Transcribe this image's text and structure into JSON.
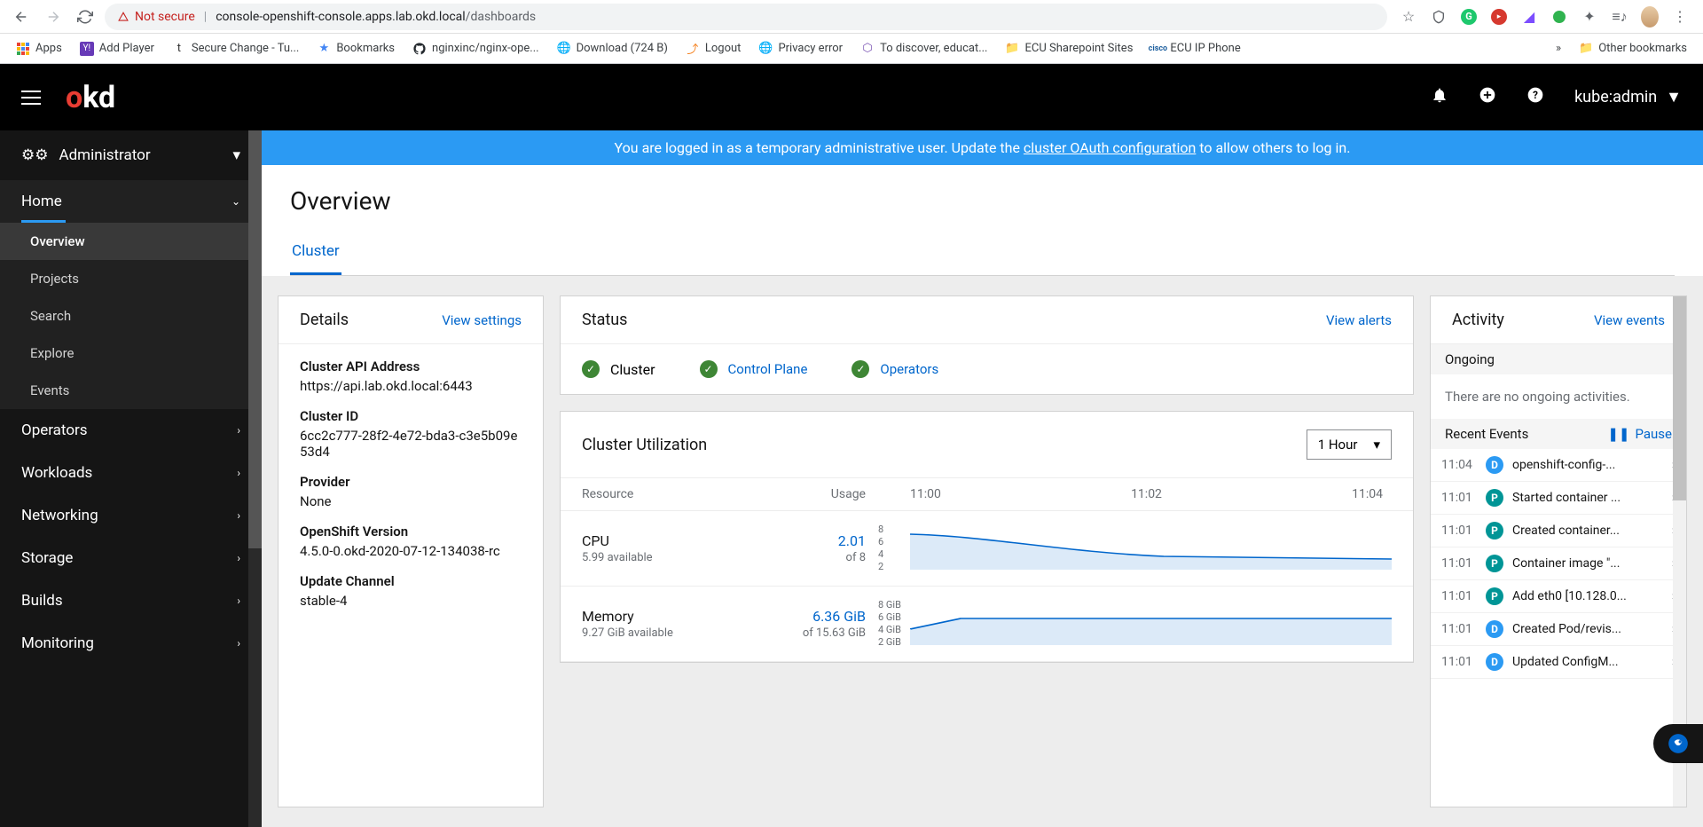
{
  "browser": {
    "not_secure": "Not secure",
    "url_host": "console-openshift-console.apps.lab.okd.local",
    "url_path": "/dashboards"
  },
  "bookmarks": {
    "apps": "Apps",
    "items": [
      "Add Player",
      "Secure Change - Tu...",
      "Bookmarks",
      "nginxinc/nginx-ope...",
      "Download (724 B)",
      "Logout",
      "Privacy error",
      "To discover, educat...",
      "ECU Sharepoint Sites",
      "ECU IP Phone"
    ],
    "other": "Other bookmarks"
  },
  "header": {
    "user": "kube:admin"
  },
  "sidebar": {
    "perspective": "Administrator",
    "home": "Home",
    "home_items": [
      "Overview",
      "Projects",
      "Search",
      "Explore",
      "Events"
    ],
    "sections": [
      "Operators",
      "Workloads",
      "Networking",
      "Storage",
      "Builds",
      "Monitoring"
    ]
  },
  "banner": {
    "pre": "You are logged in as a temporary administrative user. Update the ",
    "link": "cluster OAuth configuration",
    "post": " to allow others to log in."
  },
  "page": {
    "title": "Overview",
    "tab": "Cluster"
  },
  "details": {
    "title": "Details",
    "action": "View settings",
    "items": [
      {
        "label": "Cluster API Address",
        "value": "https://api.lab.okd.local:6443"
      },
      {
        "label": "Cluster ID",
        "value": "6cc2c777-28f2-4e72-bda3-c3e5b09e53d4"
      },
      {
        "label": "Provider",
        "value": "None"
      },
      {
        "label": "OpenShift Version",
        "value": "4.5.0-0.okd-2020-07-12-134038-rc"
      },
      {
        "label": "Update Channel",
        "value": "stable-4"
      }
    ]
  },
  "status": {
    "title": "Status",
    "action": "View alerts",
    "items": [
      {
        "label": "Cluster",
        "link": false
      },
      {
        "label": "Control Plane",
        "link": true
      },
      {
        "label": "Operators",
        "link": true
      }
    ]
  },
  "utilization": {
    "title": "Cluster Utilization",
    "range": "1 Hour",
    "resource_h": "Resource",
    "usage_h": "Usage",
    "times": [
      "11:00",
      "11:02",
      "11:04"
    ],
    "rows": [
      {
        "name": "CPU",
        "sub": "5.99 available",
        "val": "2.01",
        "valsub": "of 8",
        "ticks": [
          "8",
          "6",
          "4",
          "2"
        ]
      },
      {
        "name": "Memory",
        "sub": "9.27 GiB available",
        "val": "6.36 GiB",
        "valsub": "of 15.63 GiB",
        "ticks": [
          "8 GiB",
          "6 GiB",
          "4 GiB",
          "2 GiB"
        ]
      }
    ]
  },
  "activity": {
    "title": "Activity",
    "action": "View events",
    "ongoing_h": "Ongoing",
    "ongoing_empty": "There are no ongoing activities.",
    "recent_h": "Recent Events",
    "pause": "Pause",
    "events": [
      {
        "time": "11:04",
        "badge": "D",
        "msg": "openshift-config-..."
      },
      {
        "time": "11:01",
        "badge": "P",
        "msg": "Started container ..."
      },
      {
        "time": "11:01",
        "badge": "P",
        "msg": "Created container..."
      },
      {
        "time": "11:01",
        "badge": "P",
        "msg": "Container image \"..."
      },
      {
        "time": "11:01",
        "badge": "P",
        "msg": "Add eth0 [10.128.0..."
      },
      {
        "time": "11:01",
        "badge": "D",
        "msg": "Created Pod/revis..."
      },
      {
        "time": "11:01",
        "badge": "D",
        "msg": "Updated ConfigM..."
      }
    ]
  }
}
